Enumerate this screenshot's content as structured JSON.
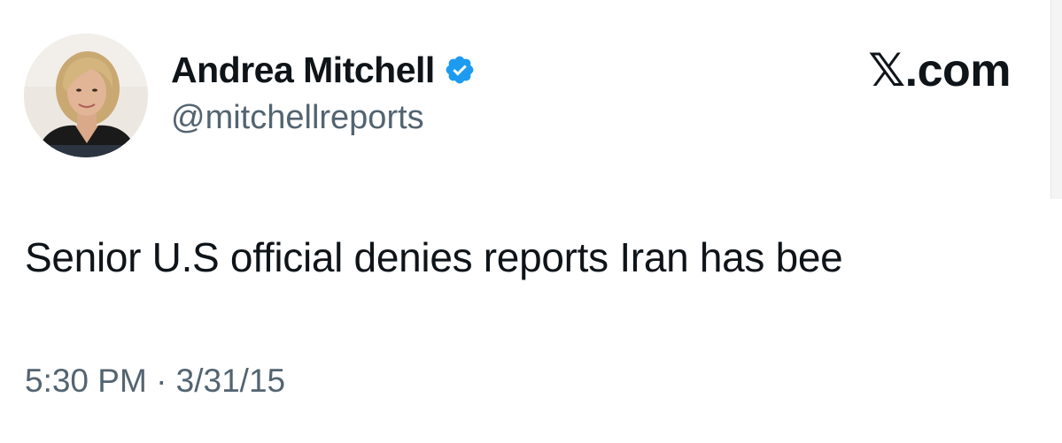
{
  "author": {
    "display_name": "Andrea Mitchell",
    "handle": "@mitchellreports",
    "verified": true,
    "verified_color": "#1d9bf0"
  },
  "brand": {
    "label": "𝕏.com"
  },
  "tweet": {
    "text": "Senior U.S official denies reports Iran has bee",
    "timestamp": "5:30 PM · 3/31/15"
  },
  "colors": {
    "primary_text": "#0f1419",
    "secondary_text": "#536471"
  }
}
